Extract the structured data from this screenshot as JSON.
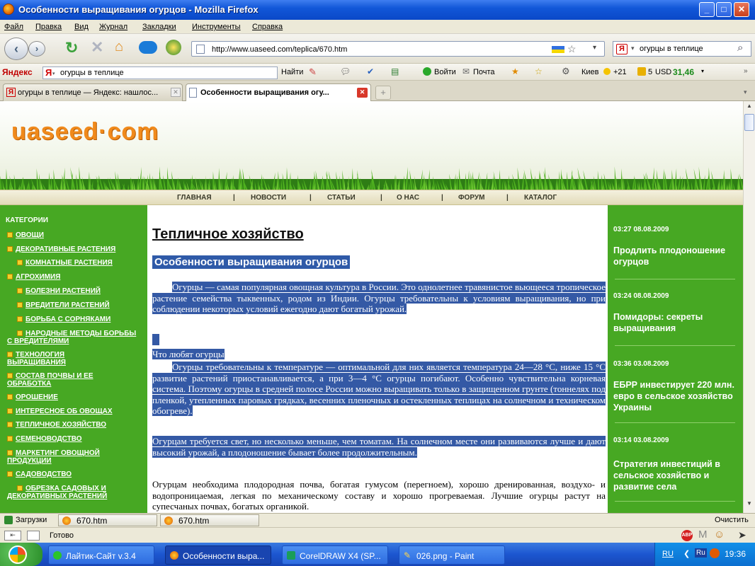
{
  "window": {
    "title": "Особенности выращивания огурцов - Mozilla Firefox"
  },
  "menu": [
    "Файл",
    "Правка",
    "Вид",
    "Журнал",
    "Закладки",
    "Инструменты",
    "Справка"
  ],
  "nav": {
    "url": "http://www.uaseed.com/teplica/670.htm",
    "search_value": "огурцы в теплице"
  },
  "yandex": {
    "brand": "Яндекс",
    "query": "огурцы в теплице",
    "find_label": "Найти",
    "login_label": "Войти",
    "mail_label": "Почта",
    "city": "Киев",
    "temp": "+21",
    "traffic": "5",
    "usd_label": "USD",
    "usd_value": "31,46"
  },
  "tabs": [
    {
      "label": "огурцы в теплице — Яндекс: нашлос..."
    },
    {
      "label": "Особенности выращивания огу..."
    }
  ],
  "page": {
    "logo": "uaseed·com",
    "topnav": [
      "ГЛАВНАЯ",
      "НОВОСТИ",
      "СТАТЬИ",
      "О НАС",
      "ФОРУМ",
      "КАТАЛОГ"
    ],
    "topnav_sep": "|",
    "categories_header": "КАТЕГОРИИ",
    "categories": [
      "ОВОЩИ",
      "ДЕКОРАТИВНЫЕ РАСТЕНИЯ",
      "КОМНАТНЫЕ РАСТЕНИЯ",
      "АГРОХИМИЯ",
      "БОЛЕЗНИ РАСТЕНИЙ",
      "ВРЕДИТЕЛИ РАСТЕНИЙ",
      "БОРЬБА С СОРНЯКАМИ",
      "НАРОДНЫЕ МЕТОДЫ БОРЬБЫ С ВРЕДИТЕЛЯМИ",
      "ТЕХНОЛОГИЯ ВЫРАЩИВАНИЯ",
      "СОСТАВ ПОЧВЫ И ЕЕ ОБРАБОТКА",
      "ОРОШЕНИЕ",
      "ИНТЕРЕСНОЕ ОБ ОВОЩАХ",
      "ТЕПЛИЧНОЕ ХОЗЯЙСТВО",
      "СЕМЕНОВОДСТВО",
      "МАРКЕТИНГ ОВОЩНОЙ ПРОДУКЦИИ",
      "САДОВОДСТВО",
      "ОБРЕЗКА САДОВЫХ И ДЕКОРАТИВНЫХ РАСТЕНИЙ"
    ],
    "h1": "Тепличное хозяйство",
    "h2": "Особенности выращивания огурцов",
    "p1": "Огурцы — самая популярная овощная культура в России. Это однолетнее травянистое вьющееся тропическое растение семейства тыквенных, родом из Индии. Огурцы требовательны к условиям выращивания, но при соблюдении некоторых условий ежегодно дают богатый урожай.",
    "subhead": "Что любят огурцы",
    "p2": "Огурцы требовательны к температуре — оптимальной для них является температура 24—28 °С, ниже 15 °С развитие растений приостанавливается, а при 3—4 °С огурцы погибают. Особенно чувствительна корневая система. Поэтому огурцы в средней полосе России можно выращивать только в защищенном грунте (тоннелях под пленкой, утепленных паровых грядках, весенних пленочных и остекленных теплицах на солнечном и техническом обогреве).",
    "p3": "Огурцам требуется свет, но несколько меньше, чем томатам. На солнечном месте они развиваются лучше и дают высокий урожай, а плодоношение бывает более продолжительным.",
    "p4": "Огурцам необходима плодородная почва, богатая гумусом (перегноем), хорошо дренированная, воздухо- и водопроницаемая, легкая по механическому составу и хорошо прогреваемая. Лучшие огурцы растут на супесчаных почвах, богатых органикой.",
    "news": [
      {
        "date": "03:27 08.08.2009",
        "title": "Продлить плодоношение огурцов"
      },
      {
        "date": "03:24 08.08.2009",
        "title": "Помидоры: секреты выращивания"
      },
      {
        "date": "03:36 03.08.2009",
        "title": "ЕБРР инвестирует 220 млн. евро в сельское хозяйство Украины"
      },
      {
        "date": "03:14 03.08.2009",
        "title": "Стратегия инвестиций в сельское хозяйство и развитие села"
      }
    ]
  },
  "downloads": {
    "label": "Загрузки",
    "items": [
      "670.htm",
      "670.htm"
    ],
    "clear": "Очистить"
  },
  "status": {
    "text": "Готово"
  },
  "taskbar": {
    "tasks": [
      "Лайтик-Сайт v.3.4",
      "Особенности выра...",
      "CorelDRAW X4 (SP...",
      "026.png - Paint"
    ],
    "lang": "RU",
    "tray_lang": "Ru",
    "clock": "19:36"
  }
}
